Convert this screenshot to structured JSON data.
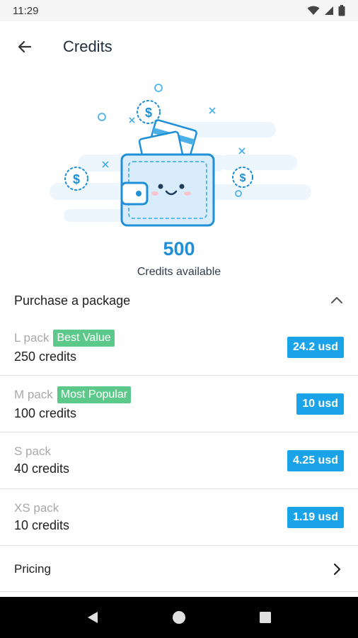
{
  "status_bar": {
    "time": "11:29"
  },
  "app_bar": {
    "title": "Credits"
  },
  "balance": {
    "count": "500",
    "label": "Credits available"
  },
  "purchase": {
    "title": "Purchase a package",
    "packs": [
      {
        "name": "L pack",
        "badge": "Best Value",
        "credits": "250 credits",
        "price": "24.2 usd"
      },
      {
        "name": "M pack",
        "badge": "Most Popular",
        "credits": "100 credits",
        "price": "10 usd"
      },
      {
        "name": "S pack",
        "badge": "",
        "credits": "40 credits",
        "price": "4.25 usd"
      },
      {
        "name": "XS pack",
        "badge": "",
        "credits": "10 credits",
        "price": "1.19 usd"
      }
    ]
  },
  "pricing": {
    "label": "Pricing"
  },
  "colors": {
    "accent": "#1aa3e8",
    "badge": "#5cc98a",
    "balance": "#1f8fd6"
  },
  "icons": [
    "wifi-icon",
    "signal-icon",
    "battery-icon",
    "back-arrow-icon",
    "wallet-illustration",
    "chevron-up-icon",
    "chevron-right-icon",
    "nav-back-icon",
    "nav-home-icon",
    "nav-recents-icon"
  ]
}
